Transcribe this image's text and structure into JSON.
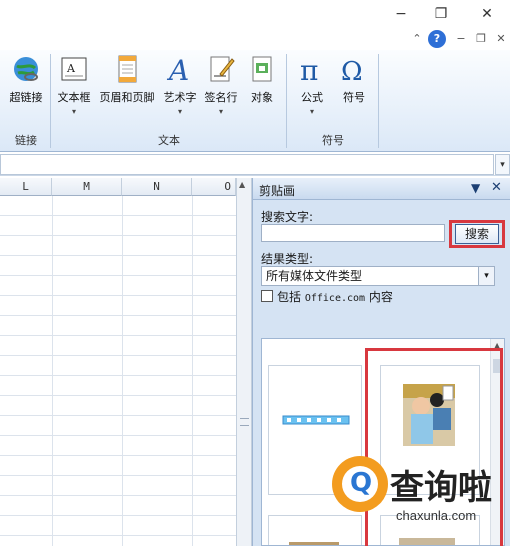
{
  "window_controls": {
    "minimize": "−",
    "restore": "❐",
    "close": "✕"
  },
  "subbar": {
    "collapse": "⌃",
    "help": "?",
    "min": "−",
    "restore": "❐",
    "close": "✕"
  },
  "ribbon": {
    "groups": [
      {
        "label": "链接",
        "buttons": [
          {
            "label": "超链接",
            "icon": "globe-link-icon",
            "dropdown": false
          }
        ]
      },
      {
        "label": "文本",
        "buttons": [
          {
            "label": "文本框",
            "icon": "textbox-icon",
            "dropdown": true
          },
          {
            "label": "页眉和页脚",
            "icon": "header-footer-icon",
            "dropdown": false
          },
          {
            "label": "艺术字",
            "icon": "wordart-icon",
            "dropdown": true
          },
          {
            "label": "签名行",
            "icon": "signature-line-icon",
            "dropdown": true
          },
          {
            "label": "对象",
            "icon": "object-icon",
            "dropdown": false
          }
        ]
      },
      {
        "label": "符号",
        "buttons": [
          {
            "label": "公式",
            "icon": "pi-equation-icon",
            "dropdown": true
          },
          {
            "label": "符号",
            "icon": "omega-symbol-icon",
            "dropdown": false
          }
        ]
      }
    ]
  },
  "sheet": {
    "columns": [
      "L",
      "M",
      "N",
      "O"
    ]
  },
  "clipart_pane": {
    "title": "剪贴画",
    "search_label": "搜索文字:",
    "search_value": "",
    "search_button": "搜索",
    "result_type_label": "结果类型:",
    "result_type_value": "所有媒体文件类型",
    "include_prefix": "包括",
    "include_office": "Office.com",
    "include_suffix": "内容",
    "include_checked": false
  },
  "watermark": {
    "brand": "查询啦",
    "domain": "chaxunla.com"
  },
  "colors": {
    "accent_red": "#d8383f",
    "ribbon_blue": "#dbe8f7",
    "watermark_orange": "#f39c1f",
    "watermark_blue": "#2a76d2"
  }
}
